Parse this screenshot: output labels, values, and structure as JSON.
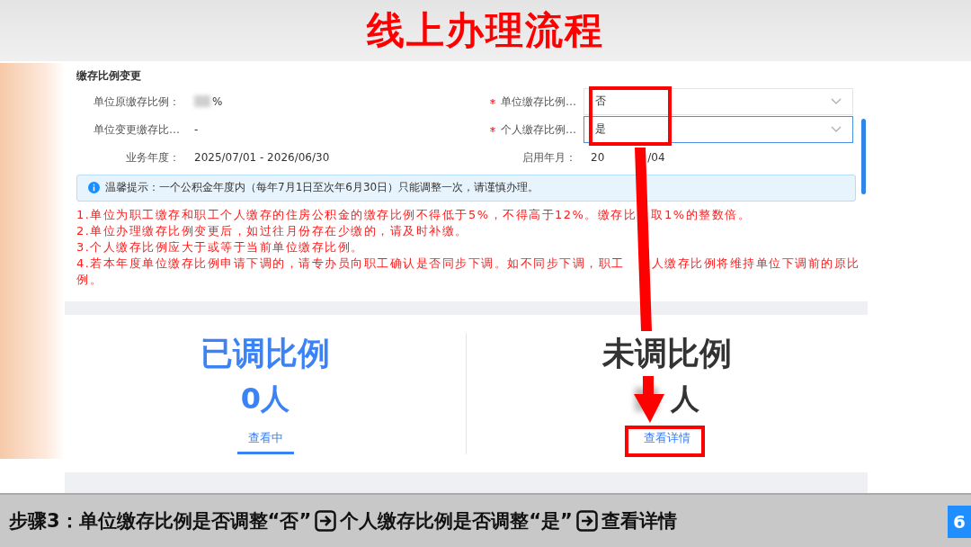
{
  "slide_title": "线上办理流程",
  "form": {
    "title": "缴存比例变更",
    "left_fields": [
      {
        "label": "单位原缴存比例：",
        "value": "%",
        "blurred": true
      },
      {
        "label": "单位变更缴存比…",
        "value": "-",
        "blurred": false
      },
      {
        "label": "业务年度：",
        "value": "2025/07/01 - 2026/06/30",
        "blurred": false
      }
    ],
    "right_fields": [
      {
        "kind": "select",
        "label": "单位缴存比例…",
        "required": true,
        "value": "否",
        "focused": false
      },
      {
        "kind": "select",
        "label": "个人缴存比例…",
        "required": true,
        "value": "是",
        "focused": true
      },
      {
        "kind": "text",
        "label": "启用年月：",
        "required": false,
        "value_parts": [
          "20",
          "/04"
        ]
      }
    ],
    "notice": "温馨提示：一个公积金年度内（每年7月1日至次年6月30日）只能调整一次，请谨慎办理。",
    "notes": [
      {
        "lines": [
          [
            "1.单位为职工缴存和职工个人缴存的住房公积金的缴存比例不得低于5%，不得高于12%。缴存比",
            "取1%的整数倍。"
          ]
        ]
      },
      {
        "lines": [
          [
            "2.单位办理缴存比例变更后，如过往月份存在少缴的，请及时补缴。"
          ]
        ]
      },
      {
        "lines": [
          [
            "3.个人缴存比例应大于或等于当前单位缴存比例。"
          ]
        ]
      },
      {
        "lines": [
          [
            "4.若本年度单位缴存比例申请下调的，请专办员向职工确认是否同步下调。如不同步下调，职工",
            "人缴存比例将维持单位下调前的原比"
          ],
          [
            "例。"
          ]
        ]
      }
    ]
  },
  "stats": [
    {
      "title": "已调比例",
      "count": "0人",
      "blurred": false,
      "link": "查看中",
      "selected": true
    },
    {
      "title": "未调比例",
      "count": "人",
      "blurred": true,
      "link": "查看详情",
      "selected": false
    }
  ],
  "step_bar": {
    "parts": [
      {
        "kind": "text",
        "text": "步骤3：单位缴存比例是否调整“否”"
      },
      {
        "kind": "arrow"
      },
      {
        "kind": "text",
        "text": "个人缴存比例是否调整“是”"
      },
      {
        "kind": "arrow"
      },
      {
        "kind": "text",
        "text": "查看详情"
      }
    ]
  },
  "page_number": "6"
}
